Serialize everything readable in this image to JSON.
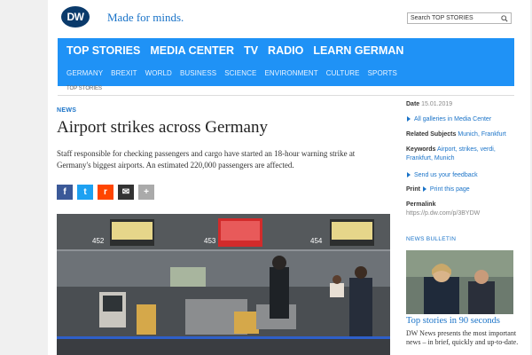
{
  "header": {
    "logo_text": "DW",
    "tagline": "Made for minds.",
    "search_placeholder": "Search TOP STORIES"
  },
  "nav": {
    "primary": [
      "TOP STORIES",
      "MEDIA CENTER",
      "TV",
      "RADIO",
      "LEARN GERMAN"
    ],
    "secondary": [
      "GERMANY",
      "BREXIT",
      "WORLD",
      "BUSINESS",
      "SCIENCE",
      "ENVIRONMENT",
      "CULTURE",
      "SPORTS"
    ]
  },
  "breadcrumb": "TOP STORIES",
  "article": {
    "kicker": "NEWS",
    "headline": "Airport strikes across Germany",
    "intro": "Staff responsible for checking passengers and cargo have started an 18-hour warning strike at Germany's biggest airports. An estimated 220,000 passengers are affected."
  },
  "share": {
    "facebook": "f",
    "twitter": "t",
    "reddit": "r",
    "email": "✉",
    "more": "+"
  },
  "sidebar": {
    "date_label": "Date",
    "date_value": "15.01.2019",
    "galleries_link": "All galleries in Media Center",
    "related_label": "Related Subjects",
    "related_links": "Munich, Frankfurt",
    "keywords_label": "Keywords",
    "keywords_line1": "Airport, strikes, verdi,",
    "keywords_line2": "Frankfurt, Munich",
    "feedback_link": "Send us your feedback",
    "print_label": "Print",
    "print_link": "Print this page",
    "permalink_label": "Permalink",
    "permalink_value": "https://p.dw.com/p/3BYDW",
    "bulletin_title": "NEWS BULLETIN",
    "bulletin_headline": "Top stories in 90 seconds",
    "bulletin_text": "DW News presents the most important news – in brief, quickly and up-to-date."
  },
  "photo_signs": {
    "sign1": "452",
    "sign2": "453",
    "sign3": "454"
  }
}
